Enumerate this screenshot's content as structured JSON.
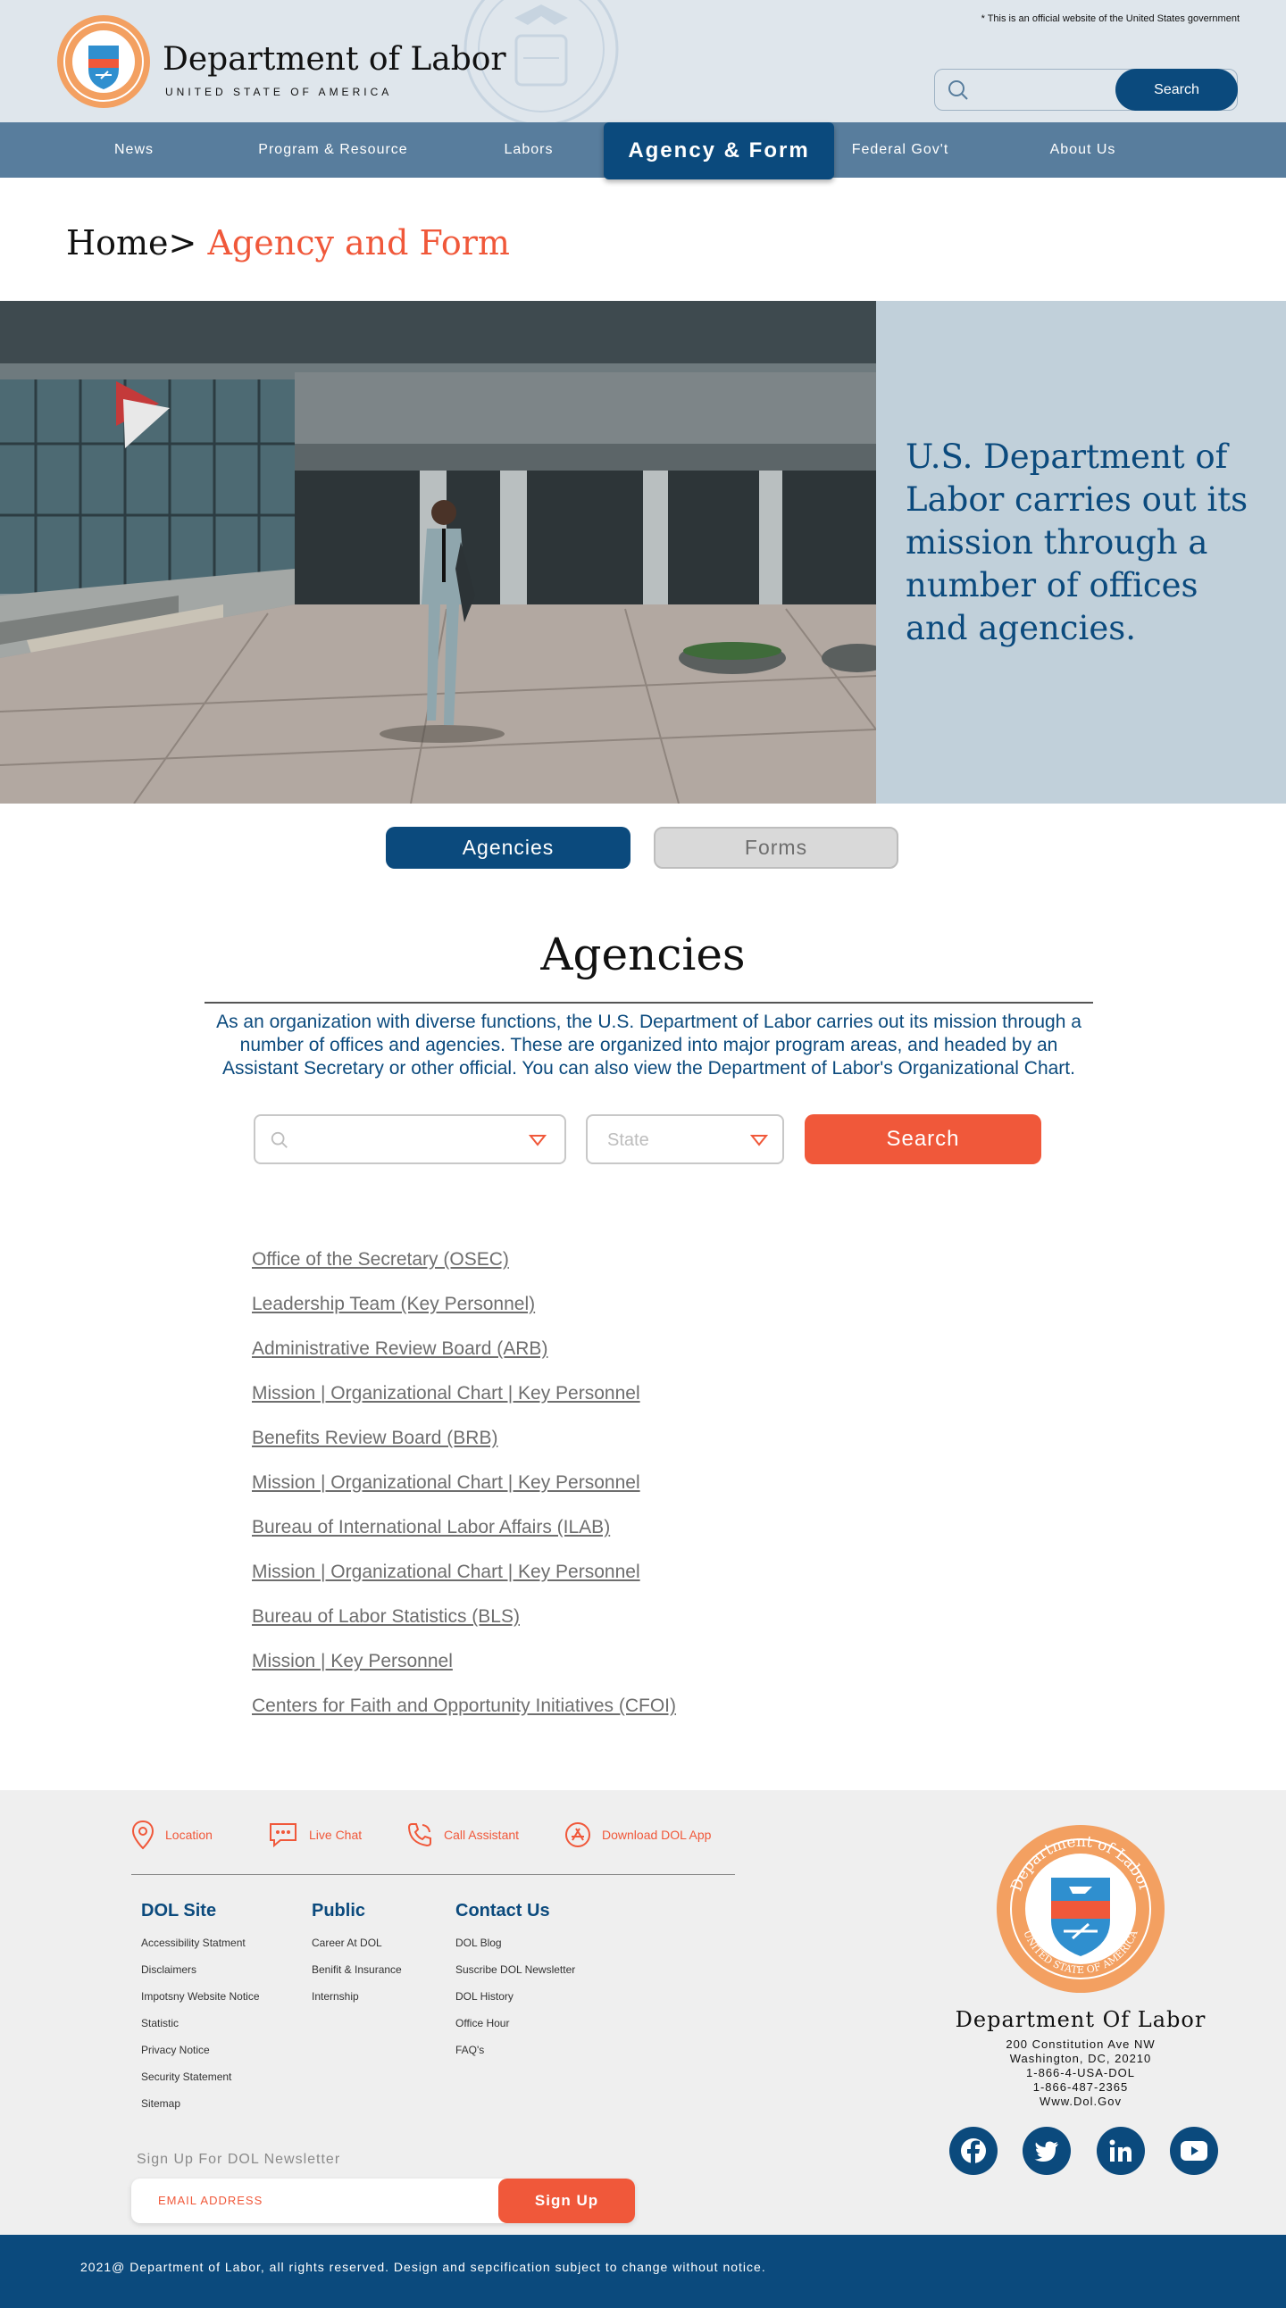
{
  "header": {
    "official_notice": "* This is an official website of the United States government",
    "brand_title": "Department of Labor",
    "brand_subtitle": "UNITED STATE OF AMERICA",
    "seal_text": "Department of Labor",
    "search_placeholder": "",
    "search_button": "Search"
  },
  "nav": {
    "items": [
      "News",
      "Program & Resource",
      "Labors",
      "Agency & Form",
      "Federal Gov't",
      "About Us"
    ],
    "active_index": 3
  },
  "breadcrumb": {
    "home": "Home>",
    "current": " Agency and Form"
  },
  "hero": {
    "text": "U.S. Department of Labor carries out its mission through a number of offices and agencies."
  },
  "tabs": {
    "agencies": "Agencies",
    "forms": "Forms",
    "active": "Agencies"
  },
  "agencies_section": {
    "title": "Agencies",
    "description": "As an organization with diverse functions, the U.S. Department of Labor carries out its mission through a number of offices and agencies. These are organized into major program areas, and headed by an Assistant Secretary or other official. You can also view the Department of Labor's Organizational Chart.",
    "filter": {
      "search_value": "",
      "state_placeholder": "State",
      "button": "Search"
    },
    "links": [
      "Office of the Secretary (OSEC)",
      "Leadership Team (Key Personnel)",
      "Administrative Review Board (ARB)",
      "Mission | Organizational Chart | Key Personnel",
      "Benefits Review Board (BRB)",
      "Mission | Organizational Chart | Key Personnel",
      "Bureau of International Labor Affairs (ILAB)",
      "Mission | Organizational Chart | Key Personnel",
      "Bureau of Labor Statistics (BLS)",
      "Mission | Key Personnel",
      "Centers for Faith and Opportunity Initiatives (CFOI)"
    ]
  },
  "footer": {
    "quick_links": [
      "Location",
      "Live Chat",
      "Call Assistant",
      "Download DOL App"
    ],
    "columns": [
      {
        "heading": "DOL Site",
        "items": [
          "Accessibility Statment",
          "Disclaimers",
          "Impotsny Website Notice",
          "Statistic",
          "Privacy Notice",
          "Security Statement",
          "Sitemap"
        ]
      },
      {
        "heading": "Public",
        "items": [
          "Career At DOL",
          "Benifit & Insurance",
          "Internship"
        ]
      },
      {
        "heading": "Contact Us",
        "items": [
          "DOL Blog",
          "Suscribe DOL Newsletter",
          "DOL History",
          "Office Hour",
          "FAQ's"
        ]
      }
    ],
    "newsletter": {
      "label": "Sign Up For DOL Newsletter",
      "placeholder": "EMAIL ADDRESS",
      "button": "Sign Up"
    },
    "org": {
      "seal_top": "Department of Labor",
      "seal_bottom": "UNITED STATE OF AMERICA",
      "name": "Department Of Labor",
      "address": [
        "200 Constitution Ave NW",
        "Washington, DC, 20210",
        "1-866-4-USA-DOL",
        "1-866-487-2365",
        "Www.Dol.Gov"
      ]
    },
    "social": [
      "facebook-icon",
      "twitter-icon",
      "linkedin-icon",
      "youtube-icon"
    ],
    "copyright": "2021@ Department of Labor, all rights reserved.  Design and sepcification subject to change without notice."
  },
  "colors": {
    "primary": "#0b4a7d",
    "accent": "#f0583a",
    "nav": "#587d9d",
    "header_bg": "#dfe6ec",
    "hero_panel": "#c1d0da"
  }
}
